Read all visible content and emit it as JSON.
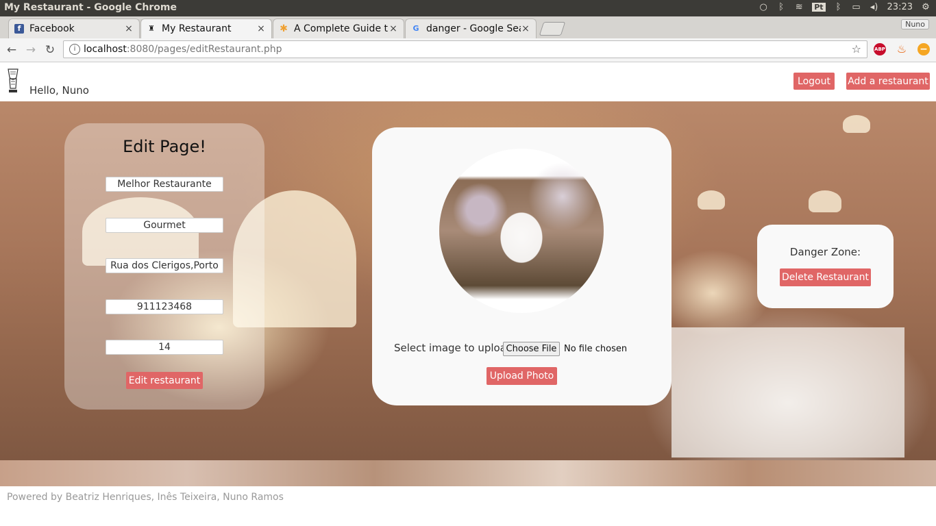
{
  "os": {
    "window_title": "My Restaurant - Google Chrome",
    "indicators": [
      "Pt"
    ],
    "time": "23:23"
  },
  "browser": {
    "tabs": [
      {
        "title": "Facebook",
        "close": "×"
      },
      {
        "title": "My Restaurant",
        "close": "×"
      },
      {
        "title": "A Complete Guide t",
        "close": "×"
      },
      {
        "title": "danger - Google Sea",
        "close": "×"
      }
    ],
    "profile": "Nuno",
    "url_host": "localhost",
    "url_rest": ":8080/pages/editRestaurant.php",
    "extensions": [
      "ABP"
    ]
  },
  "header": {
    "greeting": "Hello, Nuno",
    "logout_label": "Logout",
    "add_restaurant_label": "Add a restaurant"
  },
  "edit_panel": {
    "title": "Edit Page!",
    "fields": [
      "Melhor Restaurante",
      "Gourmet",
      "Rua dos Clerigos,Porto",
      "911123468",
      "14"
    ],
    "submit_label": "Edit restaurant"
  },
  "upload_panel": {
    "label": "Select image to upload:",
    "choose_file_label": "Choose File",
    "no_file_text": "No file chosen",
    "upload_label": "Upload Photo"
  },
  "danger_panel": {
    "title": "Danger Zone:",
    "delete_label": "Delete Restaurant"
  },
  "footer": {
    "credits": "Powered by Beatriz Henriques, Inês Teixeira, Nuno Ramos"
  },
  "colors": {
    "button": "#e06666",
    "os_bar": "#3c3b37"
  }
}
